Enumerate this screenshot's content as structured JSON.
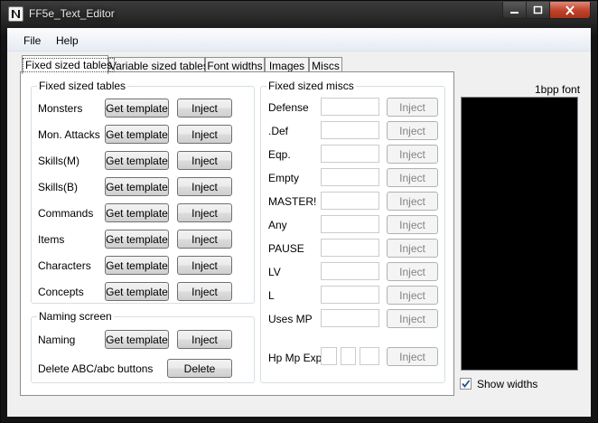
{
  "window": {
    "title": "FF5e_Text_Editor"
  },
  "menu": {
    "file": "File",
    "help": "Help"
  },
  "tabs": [
    "Fixed sized tables",
    "Variable sized tables",
    "Font widths",
    "Images",
    "Miscs"
  ],
  "fixed_tables": {
    "title": "Fixed sized tables",
    "get_template_label": "Get template",
    "inject_label": "Inject",
    "rows": [
      "Monsters",
      "Mon. Attacks",
      "Skills(M)",
      "Skills(B)",
      "Commands",
      "Items",
      "Characters",
      "Concepts"
    ]
  },
  "naming": {
    "title": "Naming screen",
    "naming_label": "Naming",
    "get_template_label": "Get template",
    "inject_label": "Inject",
    "delete_text": "Delete ABC/abc buttons",
    "delete_label": "Delete"
  },
  "miscs": {
    "title": "Fixed sized miscs",
    "inject_label": "Inject",
    "rows": [
      "Defense",
      ".Def",
      "Eqp.",
      "Empty",
      "MASTER!",
      "Any",
      "PAUSE",
      "LV",
      "L",
      "Uses MP"
    ],
    "hp_mp_exp_label": "Hp Mp Exp"
  },
  "font_panel": {
    "title": "1bpp font",
    "show_widths_label": "Show widths",
    "show_widths_checked": true
  }
}
